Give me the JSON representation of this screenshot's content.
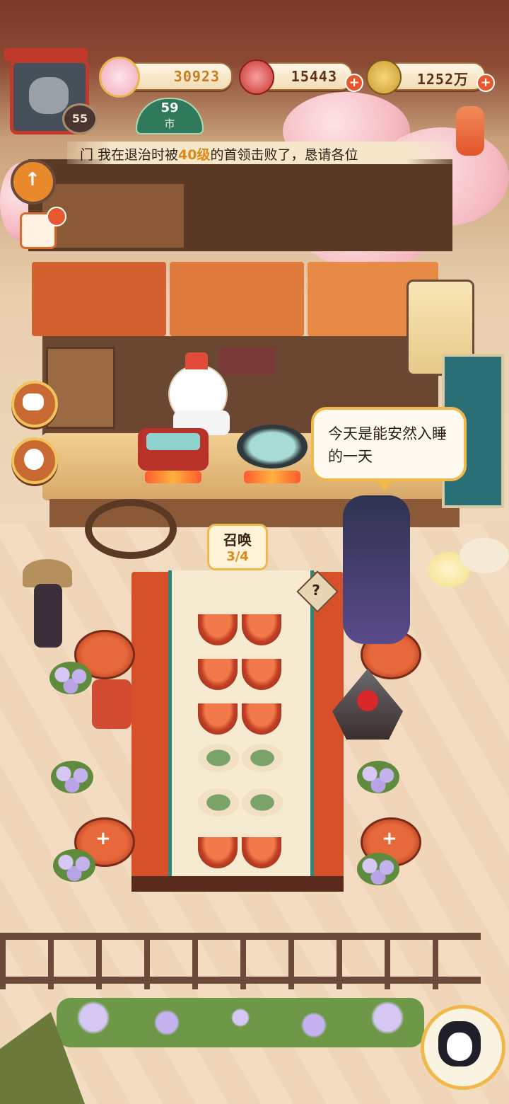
{
  "player": {
    "level": "55",
    "grade_label": "59",
    "grade_suffix": "市"
  },
  "currencies": [
    {
      "name": "blossom-currency",
      "value": "30923",
      "has_plus": false
    },
    {
      "name": "magatama-currency",
      "value": "15443",
      "has_plus": true
    },
    {
      "name": "coin-currency",
      "value": "1252万",
      "has_plus": true
    }
  ],
  "ticker": {
    "prefix": "门 我在退治时被",
    "highlight": "40级",
    "suffix": "的首领击败了，恳请各位"
  },
  "speech_bubble": {
    "text": "今天是能安然入睡的一天"
  },
  "summon": {
    "label": "召唤",
    "count": "3/4"
  },
  "help_icon": "?",
  "dishes": [
    "crab-bowl",
    "crab-bowl",
    "crab-bowl",
    "crab-bowl",
    "crab-bowl",
    "crab-bowl",
    "fish-platter",
    "vegetable-platter",
    "sushi-plate",
    "meat-plate",
    "crab-bowl",
    "crab-bowl"
  ],
  "colors": {
    "accent": "#e8582f",
    "gold": "#f0b84a",
    "wood": "#6e3b1f",
    "highlight_text": "#d98a1a"
  }
}
